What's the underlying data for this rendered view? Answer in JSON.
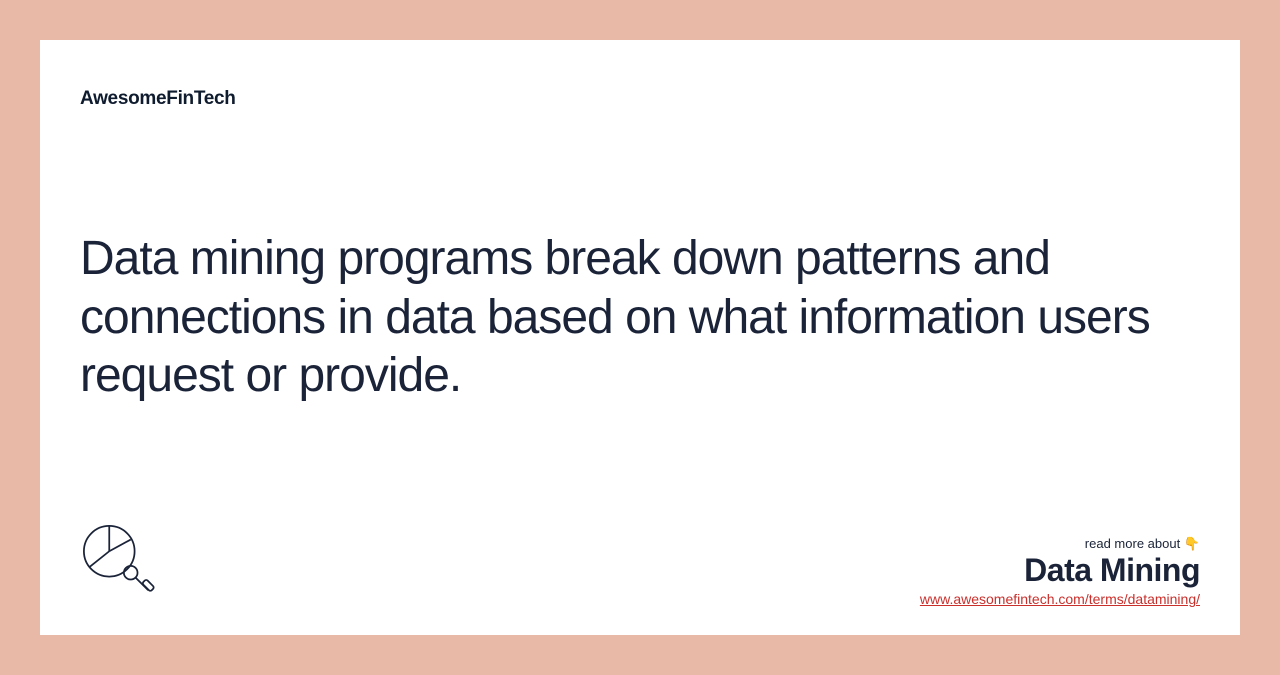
{
  "brand": "AwesomeFinTech",
  "description": "Data mining programs break down patterns and connections in data based on what information users request or provide.",
  "footer": {
    "read_more": "read more about 👇",
    "topic": "Data Mining",
    "url": "www.awesomefintech.com/terms/datamining/"
  }
}
